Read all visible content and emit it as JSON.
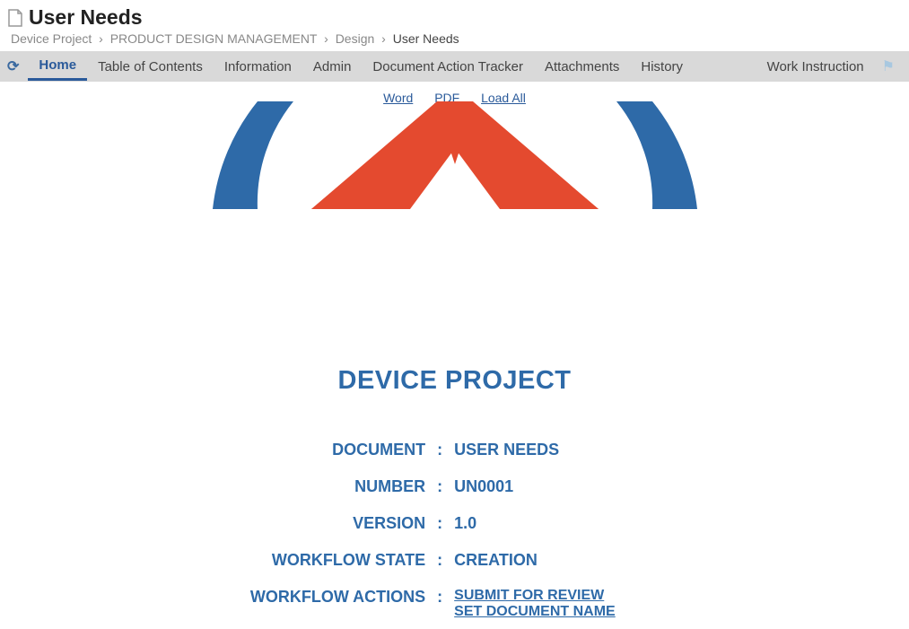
{
  "header": {
    "title": "User Needs",
    "breadcrumb": {
      "items": [
        "Device Project",
        "PRODUCT DESIGN MANAGEMENT",
        "Design"
      ],
      "current": "User Needs"
    }
  },
  "tabs": {
    "items": [
      "Home",
      "Table of Contents",
      "Information",
      "Admin",
      "Document Action Tracker",
      "Attachments",
      "History"
    ],
    "activeIndex": 0,
    "right": "Work Instruction"
  },
  "actions": {
    "word": "Word",
    "pdf": "PDF",
    "loadAll": "Load All"
  },
  "doc": {
    "projectTitle": "DEVICE PROJECT",
    "rows": {
      "document": {
        "label": "DOCUMENT",
        "value": "USER NEEDS"
      },
      "number": {
        "label": "NUMBER",
        "value": "UN0001"
      },
      "version": {
        "label": "VERSION",
        "value": "1.0"
      },
      "state": {
        "label": "WORKFLOW STATE",
        "value": "CREATION"
      },
      "actions": {
        "label": "WORKFLOW ACTIONS",
        "links": [
          "SUBMIT FOR REVIEW",
          "SET DOCUMENT NAME"
        ]
      }
    }
  }
}
